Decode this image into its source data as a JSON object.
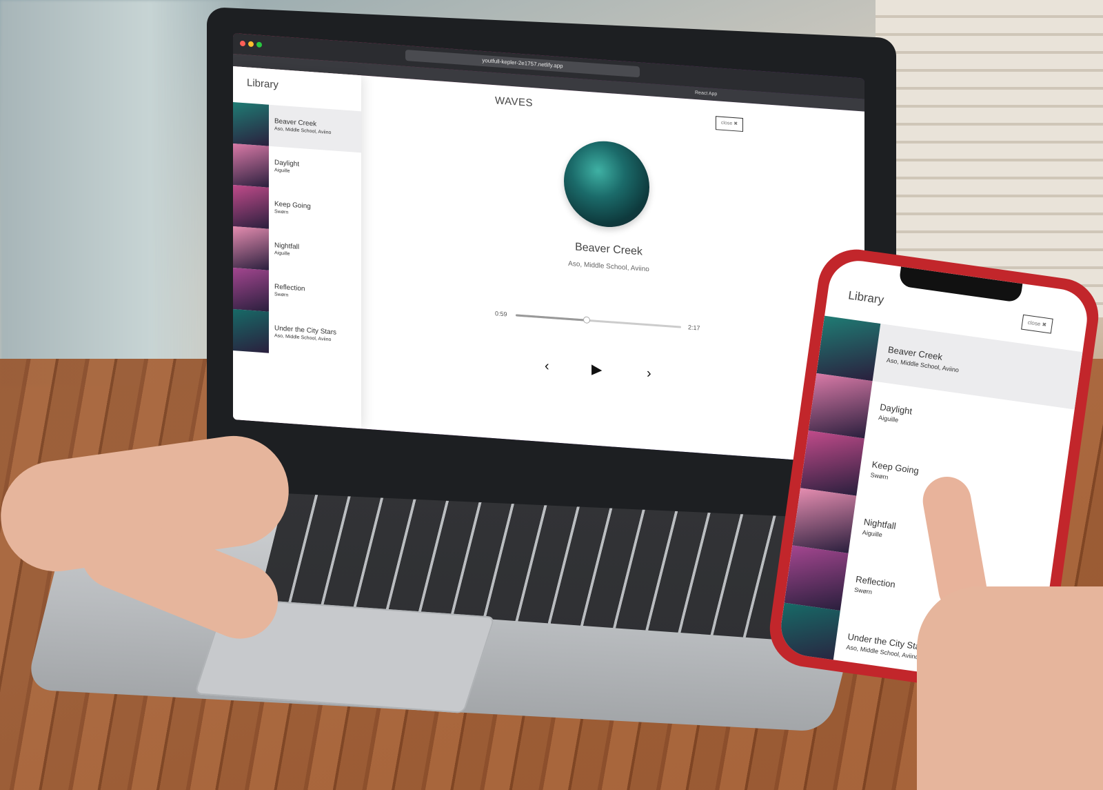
{
  "browser": {
    "url": "youtfull-kepler-2e1757.netlify.app",
    "tabs": [
      "React App"
    ]
  },
  "app": {
    "library_title": "Library",
    "nav_title": "WAVES",
    "close_label": "close",
    "now_playing": {
      "title": "Beaver Creek",
      "artist": "Aso, Middle School, Aviino",
      "current_time": "0:59",
      "duration": "2:17",
      "progress": 0.43
    },
    "songs": [
      {
        "name": "Beaver Creek",
        "artist": "Aso, Middle School, Aviino",
        "active": true,
        "color": "#1f7c74"
      },
      {
        "name": "Daylight",
        "artist": "Aiguille",
        "active": false,
        "color": "#d97aa7"
      },
      {
        "name": "Keep Going",
        "artist": "Swørn",
        "active": false,
        "color": "#c04b8a"
      },
      {
        "name": "Nightfall",
        "artist": "Aiguille",
        "active": false,
        "color": "#e58db0"
      },
      {
        "name": "Reflection",
        "artist": "Swørn",
        "active": false,
        "color": "#a3468f"
      },
      {
        "name": "Under the City Stars",
        "artist": "Aso, Middle School, Aviino",
        "active": false,
        "color": "#176a67"
      }
    ],
    "controls": {
      "prev": "‹",
      "play": "▶",
      "next": "›"
    }
  }
}
